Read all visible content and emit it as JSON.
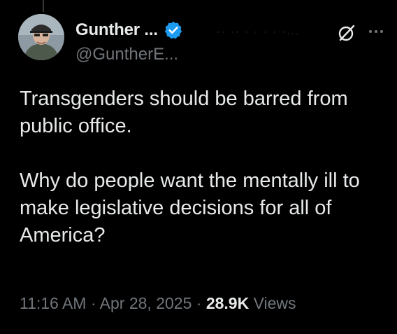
{
  "author": {
    "display_name": "Gunther ...",
    "handle": "@GuntherE...",
    "verified": true,
    "faded_header_text": "·· ·· ·  ·  ·  ·  ·..."
  },
  "icons": {
    "avatar": "profile-photo",
    "verified": "verified-badge-icon",
    "grok": "grok-icon",
    "more": "more-options-icon"
  },
  "tweet": {
    "paragraphs": [
      "Transgenders should be barred from public office.",
      "Why do people want the mentally ill to make legislative decisions for all of America?"
    ]
  },
  "meta": {
    "time": "11:16 AM",
    "separator1": " · ",
    "date": "Apr 28, 2025",
    "separator2": " · ",
    "views_count": "28.9K",
    "views_label": " Views"
  },
  "colors": {
    "background": "#000000",
    "text_primary": "#e7e9ea",
    "text_secondary": "#71767b",
    "verified_blue": "#1d9bf0"
  }
}
